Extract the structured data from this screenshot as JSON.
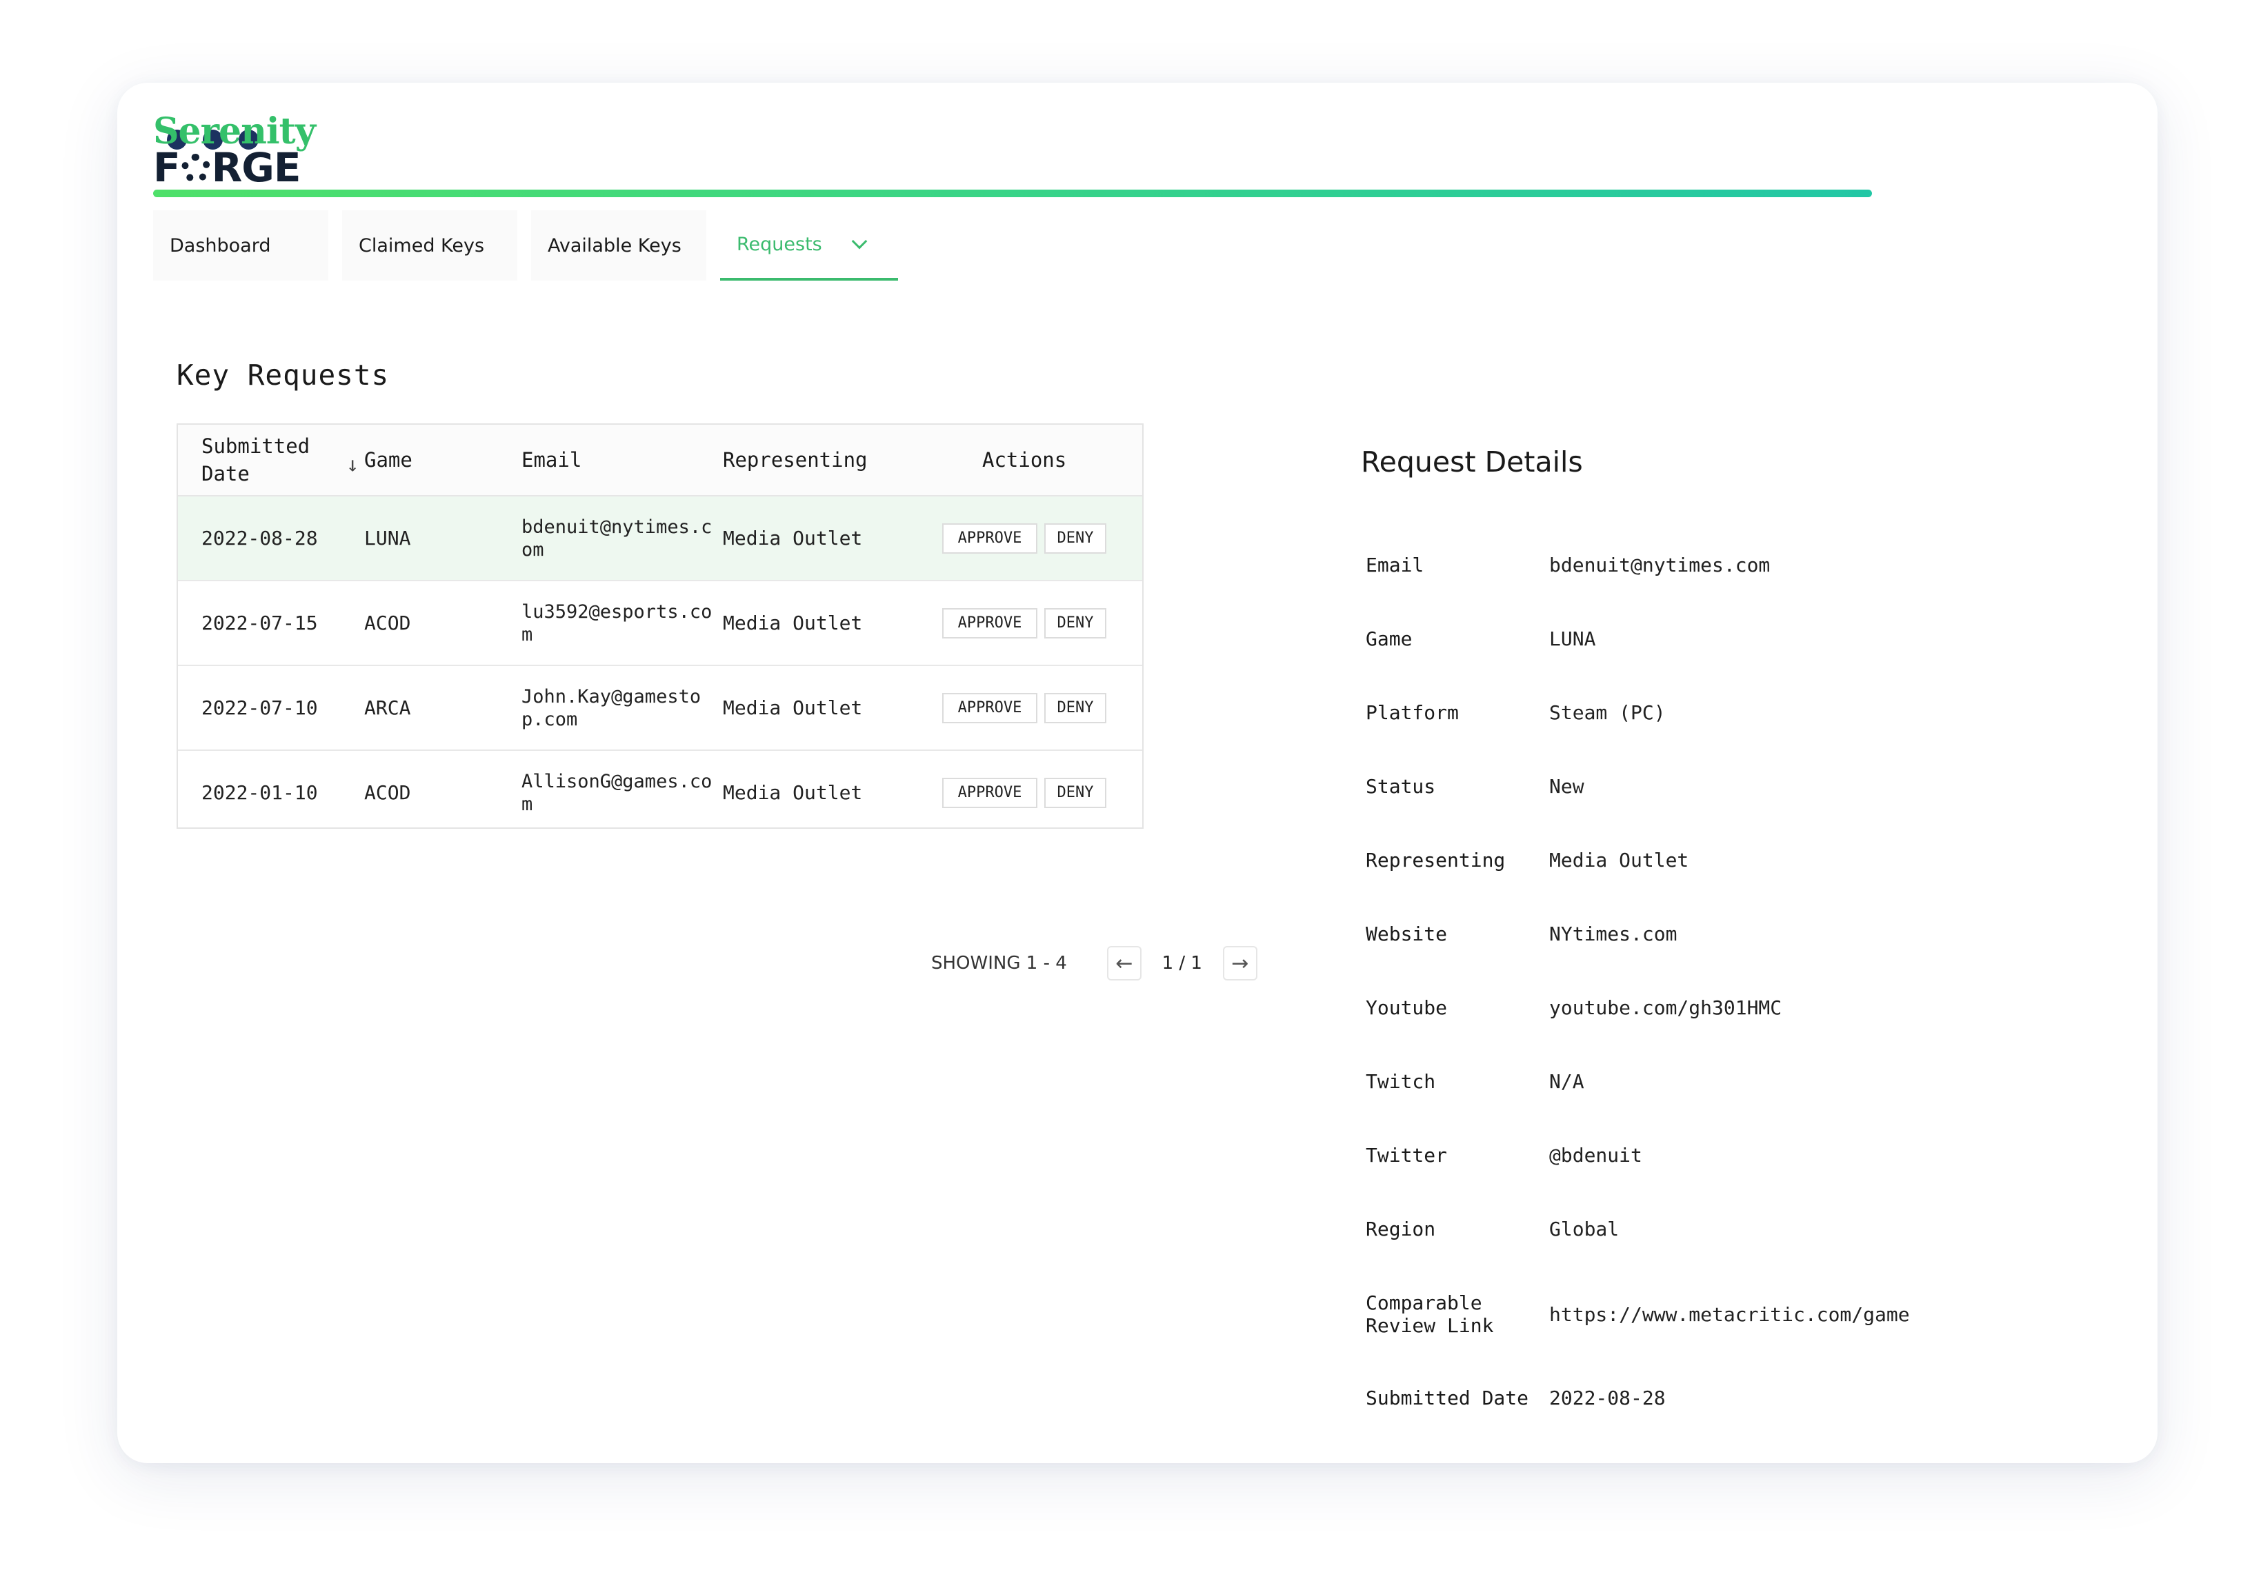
{
  "brand": {
    "logo_top": "Serenity",
    "logo_bottom_left": "F",
    "logo_bottom_right": "RGE"
  },
  "colors": {
    "accent": "#3bbb6e",
    "dots": "#1c3260",
    "selected_row": "#eef8f0"
  },
  "nav": {
    "tabs": [
      {
        "label": "Dashboard"
      },
      {
        "label": "Claimed Keys"
      },
      {
        "label": "Available Keys"
      },
      {
        "label": "Requests",
        "active": true
      }
    ]
  },
  "requests": {
    "title": "Key Requests",
    "columns": [
      "Submitted Date",
      "Game",
      "Email",
      "Representing",
      "Actions"
    ],
    "rows": [
      {
        "date": "2022-08-28",
        "game": "LUNA",
        "email": "bdenuit@nytimes.com",
        "representing": "Media Outlet"
      },
      {
        "date": "2022-07-15",
        "game": "ACOD",
        "email": "lu3592@esports.com",
        "representing": "Media Outlet"
      },
      {
        "date": "2022-07-10",
        "game": "ARCA",
        "email": "John.Kay@gamestop.com",
        "representing": "Media Outlet"
      },
      {
        "date": "2022-01-10",
        "game": "ACOD",
        "email": "AllisonG@games.com",
        "representing": "Media Outlet"
      }
    ],
    "approve_label": "APPROVE",
    "deny_label": "DENY",
    "pagination": {
      "showing": "SHOWING 1 - 4",
      "page": "1 / 1"
    }
  },
  "details": {
    "title": "Request Details",
    "fields": [
      {
        "label": "Email",
        "value": "bdenuit@nytimes.com"
      },
      {
        "label": "Game",
        "value": "LUNA"
      },
      {
        "label": "Platform",
        "value": "Steam (PC)"
      },
      {
        "label": "Status",
        "value": "New"
      },
      {
        "label": "Representing",
        "value": "Media Outlet"
      },
      {
        "label": "Website",
        "value": "NYtimes.com"
      },
      {
        "label": "Youtube",
        "value": "youtube.com/gh301HMC"
      },
      {
        "label": "Twitch",
        "value": "N/A"
      },
      {
        "label": "Twitter",
        "value": "@bdenuit"
      },
      {
        "label": "Region",
        "value": "Global"
      },
      {
        "label": "Comparable Review Link",
        "value": "https://www.metacritic.com/game"
      },
      {
        "label": "Submitted Date",
        "value": "2022-08-28"
      }
    ]
  }
}
